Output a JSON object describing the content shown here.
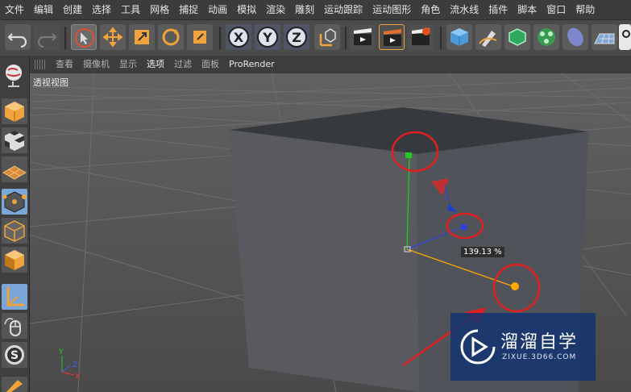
{
  "menu": [
    "文件",
    "编辑",
    "创建",
    "选择",
    "工具",
    "网格",
    "捕捉",
    "动画",
    "模拟",
    "渲染",
    "雕刻",
    "运动跟踪",
    "运动图形",
    "角色",
    "流水线",
    "插件",
    "脚本",
    "窗口",
    "帮助"
  ],
  "viewport_menu": {
    "items": [
      "查看",
      "摄像机",
      "显示",
      "选项",
      "过滤",
      "面板"
    ],
    "active_item": "选项",
    "prorender": "ProRender"
  },
  "viewport": {
    "label": "透视视图",
    "scale_readout": "139.13 %"
  },
  "watermark": {
    "title": "溜溜自学",
    "subtitle": "ZIXUE.3D66.COM"
  },
  "colors": {
    "accent_orange": "#f0a33a",
    "annotation_red": "#e02020",
    "axis_green": "#22cc22",
    "axis_blue": "#3040e0",
    "handle_orange": "#ffaa00"
  }
}
